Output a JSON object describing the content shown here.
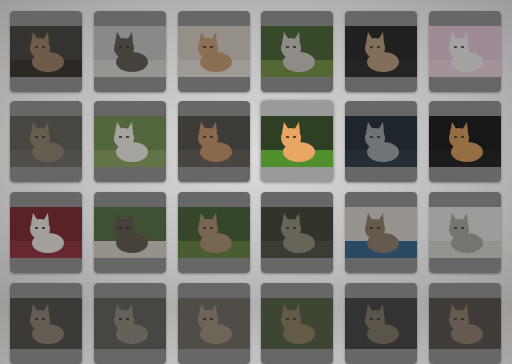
{
  "gallery": {
    "selected_index": 21,
    "thumbnails": [
      {
        "subject": "kitten-sitting",
        "bg": "#3d3b34",
        "fur": "#9a7d5e",
        "ground": "#2f2b25"
      },
      {
        "subject": "kitten-sleeping",
        "bg": "#c9c6c2",
        "fur": "#5a544e",
        "ground": "#dcd9d4"
      },
      {
        "subject": "kitten-face-closeup",
        "bg": "#d8cfc6",
        "fur": "#c79c6f",
        "ground": "#e7e0d8"
      },
      {
        "subject": "kitten-in-basket",
        "bg": "#3f5f2b",
        "fur": "#cfc9c1",
        "ground": "#6f8f3a"
      },
      {
        "subject": "kitten-on-black",
        "bg": "#1c1c1c",
        "fur": "#b89c7a",
        "ground": "#222222"
      },
      {
        "subject": "white-kitten-pink",
        "bg": "#e8c9d8",
        "fur": "#f2eeee",
        "ground": "#f0d4e2"
      },
      {
        "subject": "tabby-kitten",
        "bg": "#5c5a52",
        "fur": "#8c7e68",
        "ground": "#6a675f"
      },
      {
        "subject": "white-kitten-garden",
        "bg": "#6f8f4c",
        "fur": "#f4f1ec",
        "ground": "#86a45a"
      },
      {
        "subject": "kitten-in-box",
        "bg": "#4d4a44",
        "fur": "#c69063",
        "ground": "#5d5852"
      },
      {
        "subject": "orange-kitten-grass",
        "bg": "#2f3f24",
        "fur": "#e9a564",
        "ground": "#4f8f2e"
      },
      {
        "subject": "grey-kitten",
        "bg": "#1a2430",
        "fur": "#9aa3a8",
        "ground": "#26323e"
      },
      {
        "subject": "kitten-black-bg",
        "bg": "#0e0e0e",
        "fur": "#d89a55",
        "ground": "#151515"
      },
      {
        "subject": "kitten-red-blanket",
        "bg": "#7a1e28",
        "fur": "#efe9e2",
        "ground": "#8e2a34"
      },
      {
        "subject": "kitten-on-chair",
        "bg": "#4f6b3a",
        "fur": "#5b5247",
        "ground": "#d7d3c8"
      },
      {
        "subject": "two-kittens-playing",
        "bg": "#3f5a2a",
        "fur": "#a88d6a",
        "ground": "#5f7e38"
      },
      {
        "subject": "tabby-closeup",
        "bg": "#3a3a2e",
        "fur": "#8e8a78",
        "ground": "#4a473c"
      },
      {
        "subject": "kittens-in-bowls",
        "bg": "#dcd7cf",
        "fur": "#8a7a64",
        "ground": "#2d5f8a"
      },
      {
        "subject": "silver-tabby",
        "bg": "#e6e4e0",
        "fur": "#a9a59d",
        "ground": "#d9d6d0"
      },
      {
        "subject": "row4-a",
        "bg": "#4a4642",
        "fur": "#8a7c6c",
        "ground": "#4a4642"
      },
      {
        "subject": "row4-b",
        "bg": "#5a5a54",
        "fur": "#8a847a",
        "ground": "#5a5a54"
      },
      {
        "subject": "row4-c",
        "bg": "#6a645c",
        "fur": "#9a8c78",
        "ground": "#6a645c"
      },
      {
        "subject": "row4-d",
        "bg": "#4a5a3a",
        "fur": "#8a7a5a",
        "ground": "#4a5a3a"
      },
      {
        "subject": "row4-e",
        "bg": "#3a3a3a",
        "fur": "#7a7060",
        "ground": "#3a3a3a"
      },
      {
        "subject": "row4-f",
        "bg": "#4f4a44",
        "fur": "#8a7a68",
        "ground": "#4f4a44"
      }
    ]
  }
}
